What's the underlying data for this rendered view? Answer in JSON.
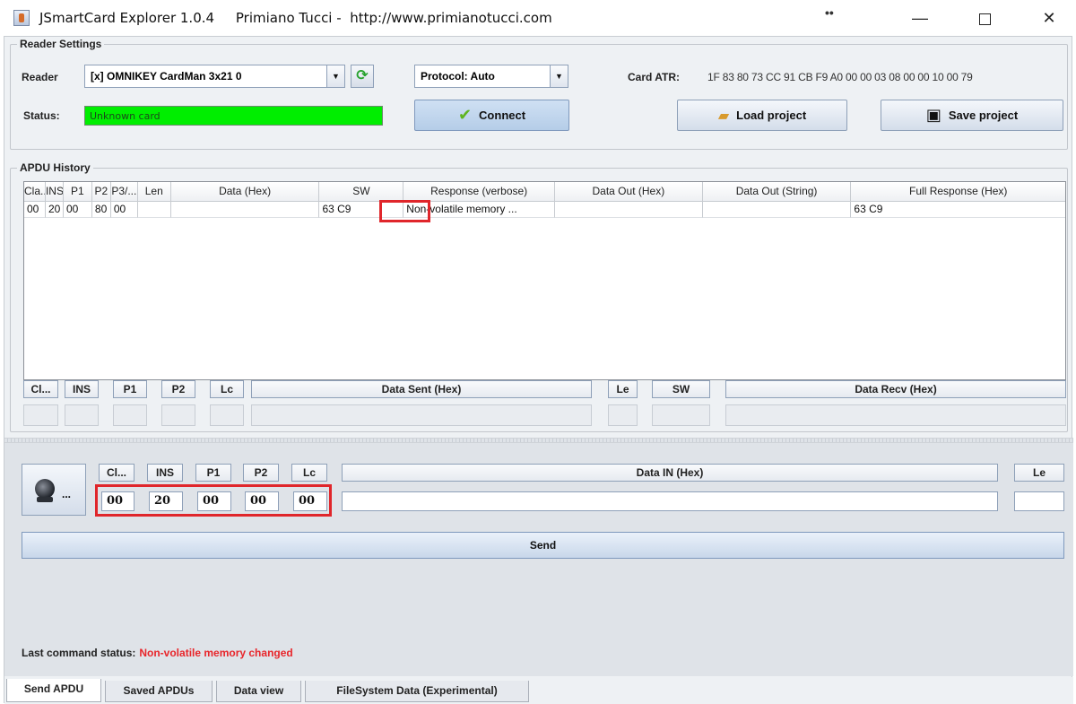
{
  "window": {
    "title": "JSmartCard Explorer 1.0.4     Primiano Tucci -  http://www.primianotucci.com",
    "dots": "••",
    "minimize": "—",
    "close": "✕"
  },
  "reader_settings": {
    "group_title": "Reader Settings",
    "reader_label": "Reader",
    "reader_value": "[x] OMNIKEY CardMan 3x21 0",
    "protocol_value": "Protocol: Auto",
    "card_atr_label": "Card ATR:",
    "card_atr_value": "1F 83 80 73 CC 91 CB F9 A0 00 00 03 08 00 00 10 00 79",
    "status_label": "Status:",
    "status_value": "Unknown card",
    "connect_label": "Connect",
    "load_project_label": "Load project",
    "save_project_label": "Save project"
  },
  "apdu_history": {
    "group_title": "APDU History",
    "columns": [
      "Cla...",
      "INS",
      "P1",
      "P2",
      "P3/...",
      "Len",
      "Data (Hex)",
      "SW",
      "Response (verbose)",
      "Data Out (Hex)",
      "Data Out (String)",
      "Full Response (Hex)"
    ],
    "rows": [
      [
        "00",
        "20",
        "00",
        "80",
        "00",
        "",
        "",
        "63 C9",
        "Non-volatile memory ...",
        "",
        "",
        "63 C9"
      ]
    ]
  },
  "detail": {
    "headers": [
      "Cl...",
      "INS",
      "P1",
      "P2",
      "Lc",
      "Data Sent (Hex)",
      "Le",
      "SW",
      "Data Recv (Hex)"
    ]
  },
  "send_apdu": {
    "headers": [
      "Cl...",
      "INS",
      "P1",
      "P2",
      "Lc",
      "Data IN (Hex)",
      "Le"
    ],
    "values": {
      "cla": "00",
      "ins": "20",
      "p1": "00",
      "p2": "00",
      "lc": "00",
      "data_in": "",
      "le": ""
    },
    "reader_button_dots": "...",
    "send_label": "Send",
    "last_status_label": "Last command status:",
    "last_status_value": "Non-volatile memory changed"
  },
  "tabs": [
    "Send APDU",
    "Saved APDUs",
    "Data view",
    "FileSystem Data (Experimental)"
  ],
  "colors": {
    "status_ok": "#00ee00",
    "error_text": "#e8262b",
    "highlight": "#e0262b"
  }
}
